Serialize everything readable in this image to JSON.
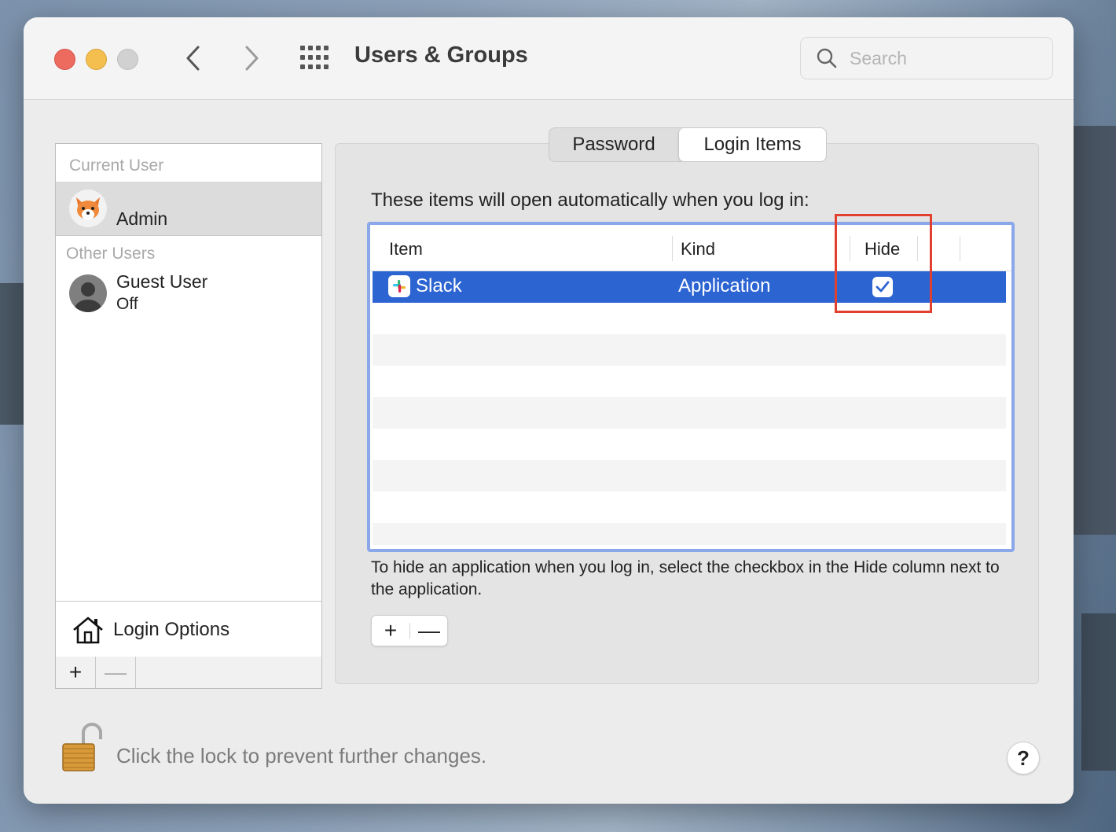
{
  "window": {
    "title": "Users & Groups",
    "search_placeholder": "Search"
  },
  "sidebar": {
    "current_user_header": "Current User",
    "current_user": {
      "name": "Admin",
      "avatar": "fox-emoji"
    },
    "other_users_header": "Other Users",
    "other_users": [
      {
        "name": "Guest User",
        "status": "Off",
        "avatar": "generic-user-icon"
      }
    ],
    "login_options_label": "Login Options",
    "add_label": "+",
    "remove_label": "—"
  },
  "tabs": [
    {
      "label": "Password",
      "active": false
    },
    {
      "label": "Login Items",
      "active": true
    }
  ],
  "login_items": {
    "intro": "These items will open automatically when you log in:",
    "columns": {
      "item": "Item",
      "kind": "Kind",
      "hide": "Hide"
    },
    "rows": [
      {
        "item": "Slack",
        "kind": "Application",
        "hide": true,
        "selected": true
      }
    ],
    "help_text": "To hide an application when you log in, select the checkbox in the Hide column next to the application.",
    "add_label": "+",
    "remove_label": "—"
  },
  "footer": {
    "lock_text": "Click the lock to prevent further changes.",
    "help_label": "?"
  },
  "colors": {
    "selection": "#2c64d2",
    "table_focus": "#8aa7ea",
    "annotation": "#e2402e"
  }
}
